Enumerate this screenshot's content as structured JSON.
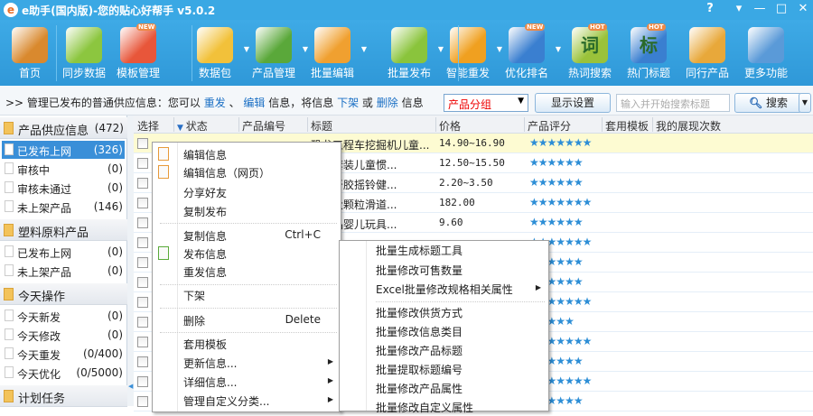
{
  "window": {
    "title": "e助手(国内版)-您的贴心好帮手 v5.0.2",
    "logo": "e",
    "help": "?",
    "menu": "▾",
    "minimize": "—",
    "maximize": "□",
    "close": "✕"
  },
  "toolbar": [
    {
      "label": "首页",
      "icon": "house-icon",
      "color": "#d9892e"
    },
    {
      "label": "同步数据",
      "icon": "download-icon",
      "color": "#8cc63f"
    },
    {
      "label": "模板管理",
      "icon": "template-wheel-icon",
      "color": "#e8563a",
      "badge": "NEW"
    },
    {
      "label": "数据包",
      "icon": "package-icon",
      "color": "#f2c13a",
      "dropdown": true
    },
    {
      "label": "产品管理",
      "icon": "gear-document-icon",
      "color": "#5aa83a",
      "dropdown": true
    },
    {
      "label": "批量编辑",
      "icon": "notepad-pencil-icon",
      "color": "#f0a030",
      "dropdown": true
    },
    {
      "label": "批量发布",
      "icon": "publish-icon",
      "color": "#8ac43c",
      "dropdown": true
    },
    {
      "label": "智能重发",
      "icon": "resend-icon",
      "color": "#f0a020",
      "dropdown": true
    },
    {
      "label": "优化排名",
      "icon": "bar-chart-icon",
      "color": "#3a7fd0",
      "badge": "NEW",
      "dropdown": true
    },
    {
      "label": "热词搜索",
      "icon": "hot-words-icon",
      "color": "#9ac23a",
      "badge": "HOT",
      "glyph": "词"
    },
    {
      "label": "热门标题",
      "icon": "hot-title-icon",
      "color": "#3a7fd0",
      "badge": "HOT",
      "glyph": "标"
    },
    {
      "label": "同行产品",
      "icon": "folder-add-icon",
      "color": "#e8a83a"
    },
    {
      "label": "更多功能",
      "icon": "monitor-icon",
      "color": "#5a9ad8"
    }
  ],
  "infobar": {
    "prefix": ">> 管理已发布的普通供应信息：您可以 ",
    "resend": "重发",
    "sep1": " 、",
    "edit": "编辑",
    "mid": " 信息，将信息 ",
    "offshelf": "下架",
    "or": " 或 ",
    "delete": "删除",
    "suffix": " 信息",
    "group": "产品分组",
    "display_settings": "显示设置",
    "search_placeholder": "输入并开始搜索标题",
    "search": "搜索"
  },
  "sidebar": {
    "sections": [
      {
        "label": "产品供应信息",
        "count": "(472)",
        "items": [
          {
            "label": "已发布上网",
            "count": "(326)",
            "selected": true
          },
          {
            "label": "审核中",
            "count": "(0)"
          },
          {
            "label": "审核未通过",
            "count": "(0)"
          },
          {
            "label": "未上架产品",
            "count": "(146)"
          }
        ]
      },
      {
        "label": "塑料原料产品",
        "items": [
          {
            "label": "已发布上网",
            "count": "(0)"
          },
          {
            "label": "未上架产品",
            "count": "(0)"
          }
        ]
      },
      {
        "label": "今天操作",
        "items": [
          {
            "label": "今天新发",
            "count": "(0)"
          },
          {
            "label": "今天修改",
            "count": "(0)"
          },
          {
            "label": "今天重发",
            "count": "(0/400)"
          },
          {
            "label": "今天优化",
            "count": "(0/5000)"
          }
        ]
      },
      {
        "label": "计划任务",
        "items": []
      }
    ]
  },
  "grid": {
    "columns": [
      "选择",
      "状态",
      "产品编号",
      "标题",
      "价格",
      "产品评分",
      "套用模板",
      "我的展现次数"
    ],
    "rows": [
      {
        "title": "恐龙工程车挖掘机儿童...",
        "price": "14.90~16.90",
        "stars": 7
      },
      {
        "title": "汽车套装儿童惯...",
        "price": "12.50~15.50",
        "stars": 6
      },
      {
        "title": "抓球牙胶摇铃健...",
        "price": "2.20~3.50",
        "stars": 6
      },
      {
        "title": "木墙大颗粒滑道...",
        "price": "182.00",
        "stars": 7
      },
      {
        "title": "消礼品婴儿玩具...",
        "price": "9.60",
        "stars": 6
      },
      {
        "title": "",
        "price": "",
        "stars": 7
      },
      {
        "title": "",
        "price": "",
        "stars": 6
      },
      {
        "title": "",
        "price": "",
        "stars": 6
      },
      {
        "title": "",
        "price": "",
        "stars": 7
      },
      {
        "title": "",
        "price": "",
        "stars": 5
      },
      {
        "title": "",
        "price": "",
        "stars": 7
      },
      {
        "title": "",
        "price": "",
        "stars": 6
      },
      {
        "title": "",
        "price": "",
        "stars": 7
      },
      {
        "title": "",
        "price": "",
        "stars": 6
      }
    ]
  },
  "context_menu": [
    {
      "label": "编辑信息",
      "icon": "edit-icon"
    },
    {
      "label": "编辑信息（网页）",
      "icon": "edit-icon"
    },
    {
      "label": "分享好友"
    },
    {
      "label": "复制发布"
    },
    {
      "sep": true
    },
    {
      "label": "复制信息",
      "shortcut": "Ctrl+C"
    },
    {
      "label": "发布信息",
      "icon": "publish-icon"
    },
    {
      "label": "重发信息"
    },
    {
      "sep": true
    },
    {
      "label": "下架"
    },
    {
      "sep": true
    },
    {
      "label": "删除",
      "shortcut": "Delete"
    },
    {
      "sep": true
    },
    {
      "label": "套用模板"
    },
    {
      "label": "更新信息...",
      "submenu": true
    },
    {
      "label": "详细信息...",
      "submenu": true
    },
    {
      "label": "管理自定义分类...",
      "submenu": true
    }
  ],
  "submenu": [
    {
      "label": "批量生成标题工具"
    },
    {
      "label": "批量修改可售数量"
    },
    {
      "label": "Excel批量修改规格相关属性",
      "submenu": true
    },
    {
      "sep": true
    },
    {
      "label": "批量修改供货方式"
    },
    {
      "label": "批量修改信息类目"
    },
    {
      "label": "批量修改产品标题"
    },
    {
      "label": "批量提取标题编号"
    },
    {
      "label": "批量修改产品属性"
    },
    {
      "label": "批量修改自定义属性"
    }
  ]
}
